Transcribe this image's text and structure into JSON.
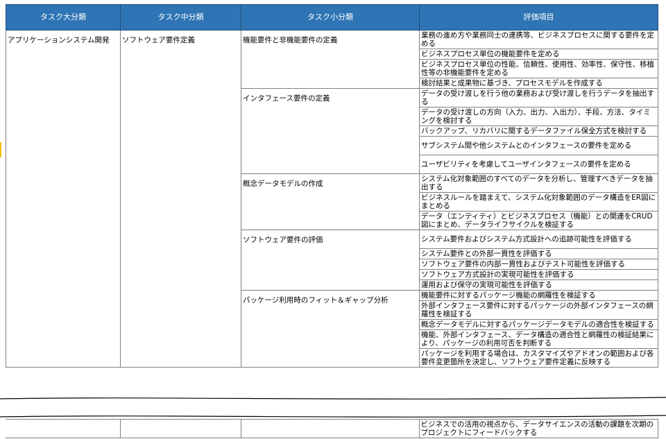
{
  "headers": [
    "タスク大分類",
    "タスク中分類",
    "タスク小分類",
    "評価項目"
  ],
  "major": "アプリケーションシステム開発",
  "middle": "ソフトウェア要件定義",
  "groups": [
    {
      "name": "機能要件と非機能要件の定義",
      "items": [
        "業務の進め方や業務同士の連携等、ビジネスプロセスに関する要件を定める",
        "ビジネスプロセス単位の機能要件を定める",
        "ビジネスプロセス単位の性能、信頼性、使用性、効率性、保守性、移植性等の非機能要件を定める",
        "検討結果と成果物に基づき、プロセスモデルを作成する"
      ]
    },
    {
      "name": "インタフェース要件の定義",
      "items": [
        "データの受け渡しを行う他の業務および受け渡しを行うデータを抽出する",
        "データの受け渡しの方向（入力、出力、入出力）、手段、方法、タイミングを検討する",
        "バックアップ、リカバリに関するデータファイル保全方式を検討する",
        "サブシステム間や他システムとのインタフェースの要件を定める",
        "ユーザビリティを考慮してユーザインタフェースの要件を定める"
      ]
    },
    {
      "name": "概念データモデルの作成",
      "items": [
        "システム化対象範囲のすべてのデータを分析し、管理すべきデータを抽出する",
        "ビジネスルールを踏まえて、システム化対象範囲のデータ構造をER図にまとめる",
        "データ（エンティティ）とビジネスプロセス（機能）との関連をCRUD図にまとめ、データライフサイクルを検証する"
      ]
    },
    {
      "name": "ソフトウェア要件の評価",
      "items": [
        "システム要件およびシステム方式設計への追跡可能性を評価する",
        "システム要件との外部一貫性を評価する",
        "ソフトウェア要件の内部一貫性およびテスト可能性を評価する",
        "ソフトウェア方式設計の実現可能性を評価する",
        "運用および保守の実現可能性を評価する"
      ]
    },
    {
      "name": "パッケージ利用時のフィット＆ギャップ分析",
      "items": [
        "機能要件に対するパッケージ機能の網羅性を検証する",
        "外部インタフェース要件に対するパッケージの外部インタフェースの網羅性を検証する",
        "概念データモデルに対するパッケージデータモデルの適合性を検証する",
        "機能、外部インタフェース、データ構造の適合性と網羅性の検証結果により、パッケージの利用可否を判断する",
        "パッケージを利用する場合は、カスタマイズやアドオンの範囲および各要件変更箇所を決定し、ソフトウェア要件定義に反映する"
      ]
    }
  ],
  "last_item": "ビジネスでの活用の視点から、データサイエンスの活動の課題を次期のプロジェクトにフィードバックする"
}
